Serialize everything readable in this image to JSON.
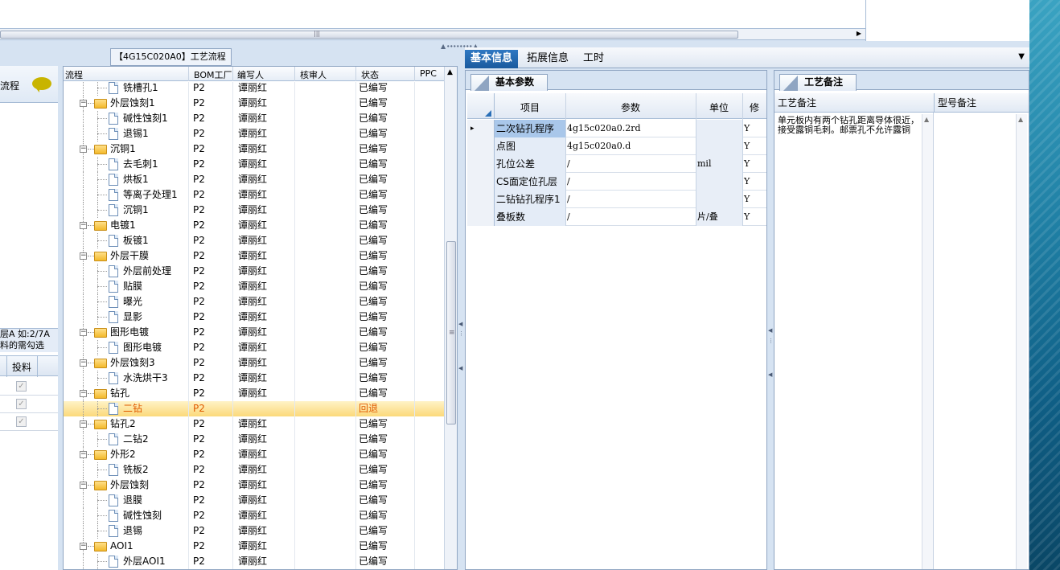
{
  "process_panel": {
    "title": "【4G15C020A0】工艺流程",
    "columns": [
      "流程",
      "BOM工厂",
      "编写人",
      "核审人",
      "状态",
      "PPC"
    ],
    "rows": [
      {
        "level": 2,
        "type": "doc",
        "name": "铣槽孔1",
        "bom": "P2",
        "writer": "谭丽红",
        "reviewer": "",
        "status": "已编写"
      },
      {
        "level": 1,
        "type": "folder",
        "name": "外层蚀刻1",
        "bom": "P2",
        "writer": "谭丽红",
        "reviewer": "",
        "status": "已编写"
      },
      {
        "level": 2,
        "type": "doc",
        "name": "碱性蚀刻1",
        "bom": "P2",
        "writer": "谭丽红",
        "reviewer": "",
        "status": "已编写"
      },
      {
        "level": 2,
        "type": "doc",
        "name": "退锡1",
        "bom": "P2",
        "writer": "谭丽红",
        "reviewer": "",
        "status": "已编写"
      },
      {
        "level": 1,
        "type": "folder",
        "name": "沉铜1",
        "bom": "P2",
        "writer": "谭丽红",
        "reviewer": "",
        "status": "已编写"
      },
      {
        "level": 2,
        "type": "doc",
        "name": "去毛刺1",
        "bom": "P2",
        "writer": "谭丽红",
        "reviewer": "",
        "status": "已编写"
      },
      {
        "level": 2,
        "type": "doc",
        "name": "烘板1",
        "bom": "P2",
        "writer": "谭丽红",
        "reviewer": "",
        "status": "已编写"
      },
      {
        "level": 2,
        "type": "doc",
        "name": "等离子处理1",
        "bom": "P2",
        "writer": "谭丽红",
        "reviewer": "",
        "status": "已编写"
      },
      {
        "level": 2,
        "type": "doc",
        "name": "沉铜1",
        "bom": "P2",
        "writer": "谭丽红",
        "reviewer": "",
        "status": "已编写"
      },
      {
        "level": 1,
        "type": "folder",
        "name": "电镀1",
        "bom": "P2",
        "writer": "谭丽红",
        "reviewer": "",
        "status": "已编写"
      },
      {
        "level": 2,
        "type": "doc",
        "name": "板镀1",
        "bom": "P2",
        "writer": "谭丽红",
        "reviewer": "",
        "status": "已编写"
      },
      {
        "level": 1,
        "type": "folder",
        "name": "外层干膜",
        "bom": "P2",
        "writer": "谭丽红",
        "reviewer": "",
        "status": "已编写"
      },
      {
        "level": 2,
        "type": "doc",
        "name": "外层前处理",
        "bom": "P2",
        "writer": "谭丽红",
        "reviewer": "",
        "status": "已编写"
      },
      {
        "level": 2,
        "type": "doc",
        "name": "贴膜",
        "bom": "P2",
        "writer": "谭丽红",
        "reviewer": "",
        "status": "已编写"
      },
      {
        "level": 2,
        "type": "doc",
        "name": "曝光",
        "bom": "P2",
        "writer": "谭丽红",
        "reviewer": "",
        "status": "已编写"
      },
      {
        "level": 2,
        "type": "doc",
        "name": "显影",
        "bom": "P2",
        "writer": "谭丽红",
        "reviewer": "",
        "status": "已编写"
      },
      {
        "level": 1,
        "type": "folder",
        "name": "图形电镀",
        "bom": "P2",
        "writer": "谭丽红",
        "reviewer": "",
        "status": "已编写"
      },
      {
        "level": 2,
        "type": "doc",
        "name": "图形电镀",
        "bom": "P2",
        "writer": "谭丽红",
        "reviewer": "",
        "status": "已编写"
      },
      {
        "level": 1,
        "type": "folder",
        "name": "外层蚀刻3",
        "bom": "P2",
        "writer": "谭丽红",
        "reviewer": "",
        "status": "已编写"
      },
      {
        "level": 2,
        "type": "doc",
        "name": "水洗烘干3",
        "bom": "P2",
        "writer": "谭丽红",
        "reviewer": "",
        "status": "已编写"
      },
      {
        "level": 1,
        "type": "folder",
        "name": "钻孔",
        "bom": "P2",
        "writer": "谭丽红",
        "reviewer": "",
        "status": "已编写"
      },
      {
        "level": 2,
        "type": "doc",
        "name": "二钻",
        "bom": "P2",
        "writer": "",
        "reviewer": "",
        "status": "回退",
        "selected": true
      },
      {
        "level": 1,
        "type": "folder",
        "name": "钻孔2",
        "bom": "P2",
        "writer": "谭丽红",
        "reviewer": "",
        "status": "已编写"
      },
      {
        "level": 2,
        "type": "doc",
        "name": "二钻2",
        "bom": "P2",
        "writer": "谭丽红",
        "reviewer": "",
        "status": "已编写"
      },
      {
        "level": 1,
        "type": "folder",
        "name": "外形2",
        "bom": "P2",
        "writer": "谭丽红",
        "reviewer": "",
        "status": "已编写"
      },
      {
        "level": 2,
        "type": "doc",
        "name": "铣板2",
        "bom": "P2",
        "writer": "谭丽红",
        "reviewer": "",
        "status": "已编写"
      },
      {
        "level": 1,
        "type": "folder",
        "name": "外层蚀刻",
        "bom": "P2",
        "writer": "谭丽红",
        "reviewer": "",
        "status": "已编写"
      },
      {
        "level": 2,
        "type": "doc",
        "name": "退膜",
        "bom": "P2",
        "writer": "谭丽红",
        "reviewer": "",
        "status": "已编写"
      },
      {
        "level": 2,
        "type": "doc",
        "name": "碱性蚀刻",
        "bom": "P2",
        "writer": "谭丽红",
        "reviewer": "",
        "status": "已编写"
      },
      {
        "level": 2,
        "type": "doc",
        "name": "退锡",
        "bom": "P2",
        "writer": "谭丽红",
        "reviewer": "",
        "status": "已编写"
      },
      {
        "level": 1,
        "type": "folder",
        "name": "AOI1",
        "bom": "P2",
        "writer": "谭丽红",
        "reviewer": "",
        "status": "已编写"
      },
      {
        "level": 2,
        "type": "doc",
        "name": "外层AOI1",
        "bom": "P2",
        "writer": "谭丽红",
        "reviewer": "",
        "status": "已编写"
      }
    ]
  },
  "left_panel": {
    "header_text": "流程",
    "note_line1": "层A 如:2/7A",
    "note_line2": "料的需勾选",
    "column_label": "投料",
    "checks": [
      true,
      true,
      true
    ]
  },
  "tabs": [
    "基本信息",
    "拓展信息",
    "工时"
  ],
  "basic_params": {
    "tab_label": "基本参数",
    "columns": [
      "项目",
      "参数",
      "单位",
      "修"
    ],
    "rows": [
      {
        "item": "二次钻孔程序",
        "param": "4g15c020a0.2rd",
        "unit": "",
        "flag": "Y",
        "current": true
      },
      {
        "item": "点图",
        "param": "4g15c020a0.d",
        "unit": "",
        "flag": "Y"
      },
      {
        "item": "孔位公差",
        "param": "/",
        "unit": "mil",
        "flag": "Y"
      },
      {
        "item": "CS面定位孔层",
        "param": "/",
        "unit": "",
        "flag": "Y"
      },
      {
        "item": "二钻钻孔程序1",
        "param": "/",
        "unit": "",
        "flag": "Y"
      },
      {
        "item": "叠板数",
        "param": "/",
        "unit": "片/叠",
        "flag": "Y"
      }
    ]
  },
  "process_notes": {
    "tab_label": "工艺备注",
    "col1": "工艺备注",
    "col2": "型号备注",
    "text": "单元板内有两个钻孔距离导体很近，接受露铜毛刺。邮票孔不允许露铜"
  },
  "colors": {
    "accent": "#1a5a9e",
    "selected_row": "#fbd97a",
    "rollback_text": "#e05a00"
  }
}
